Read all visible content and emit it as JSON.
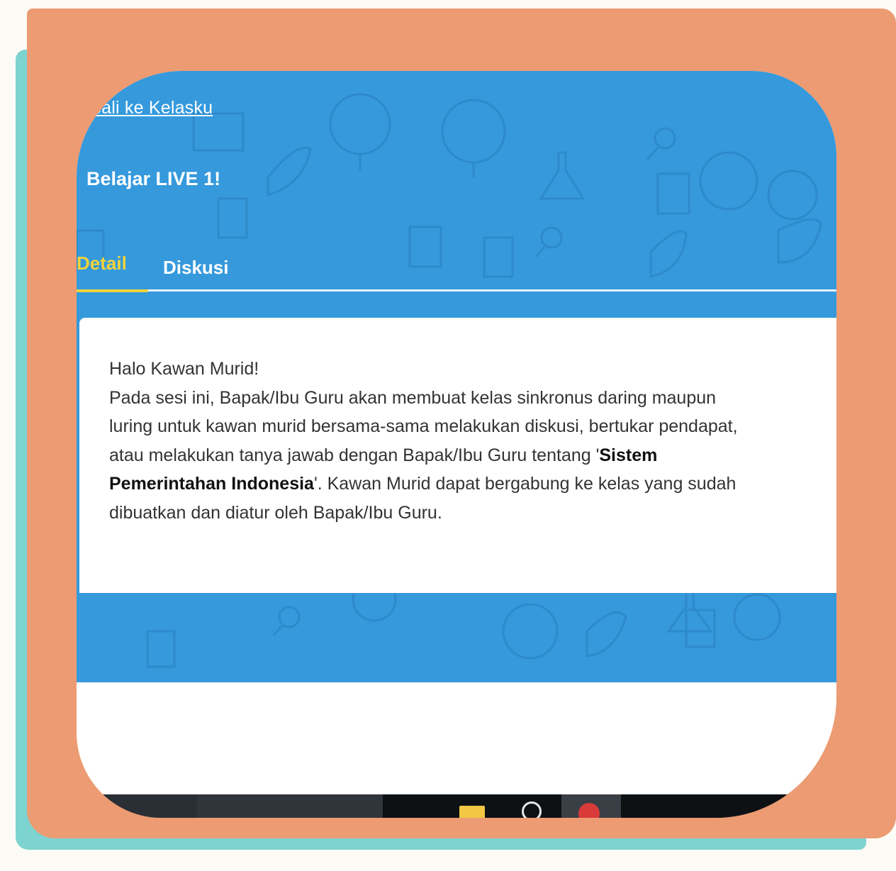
{
  "header": {
    "back_link": "mbali ke Kelasku",
    "title": "Belajar LIVE 1!"
  },
  "tabs": [
    {
      "label": "Detail",
      "active": true
    },
    {
      "label": "Diskusi",
      "active": false
    }
  ],
  "content": {
    "greeting": "Halo Kawan Murid!",
    "body_lines": [
      "Pada sesi ini, Bapak/Ibu Guru akan membuat kelas sinkronus daring maupun",
      "luring untuk kawan murid bersama-sama melakukan diskusi, bertukar pendapat,",
      "atau melakukan tanya jawab dengan Bapak/Ibu Guru tentang '"
    ],
    "topic_part1": "Sistem",
    "topic_part2": "Pemerintahan Indonesia",
    "after_topic": "'. Kawan Murid dapat bergabung ke kelas yang sudah",
    "closing_line": "dibuatkan dan diatur oleh Bapak/Ibu Guru."
  },
  "taskbar": {
    "icons": [
      "folder-icon",
      "no-sign-icon",
      "record-icon"
    ]
  },
  "colors": {
    "teal_frame": "#7dd3cf",
    "orange_frame": "#ec9b72",
    "header_blue": "#3599dc",
    "active_tab": "#f0d33c"
  }
}
